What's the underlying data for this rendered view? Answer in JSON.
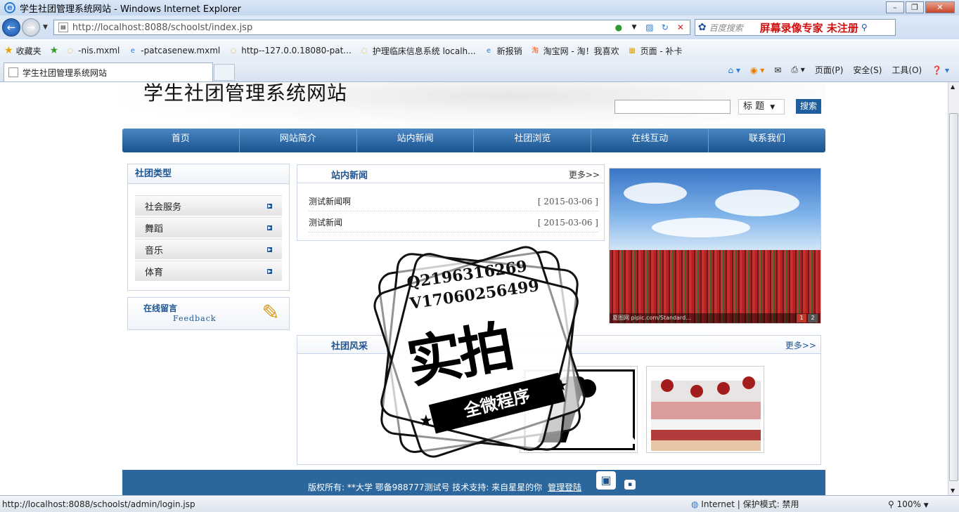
{
  "browser": {
    "window_title": "学生社团管理系统网站 - Windows Internet Explorer",
    "window_buttons": {
      "minimize": "–",
      "maximize": "❐",
      "close": "✕"
    },
    "address": "http://localhost:8088/schoolst/index.jsp",
    "search_placeholder": "百度搜索",
    "search_ad": "屏幕录像专家 未注册",
    "favorites_label": "收藏夹",
    "favorites": [
      {
        "label": "-nis.mxml",
        "icon": "loading-icon"
      },
      {
        "label": "-patcasenew.mxml",
        "icon": "ie-page-icon"
      },
      {
        "label": "http--127.0.0.18080-pat...",
        "icon": "loading-icon"
      },
      {
        "label": "护理临床信息系统 localh...",
        "icon": "loading-icon"
      },
      {
        "label": "新报销",
        "icon": "ie-page-icon"
      },
      {
        "label": "淘宝网 - 淘！我喜欢",
        "icon": "taobao-icon"
      },
      {
        "label": "页面 - 补卡",
        "icon": "page-icon"
      }
    ],
    "tab_title": "学生社团管理系统网站",
    "commands": {
      "page": "页面(P)",
      "safety": "安全(S)",
      "tools": "工具(O)"
    },
    "status_url": "http://localhost:8088/schoolst/admin/login.jsp",
    "status_zone": "Internet | 保护模式: 禁用",
    "status_zoom": "100%"
  },
  "site": {
    "title": "学生社团管理系统网站",
    "search": {
      "select_value": "标 题",
      "button": "搜索"
    },
    "nav": [
      "首页",
      "网站简介",
      "站内新闻",
      "社团浏览",
      "在线互动",
      "联系我们"
    ],
    "categories": {
      "title": "社团类型",
      "items": [
        "社会服务",
        "舞蹈",
        "音乐",
        "体育"
      ]
    },
    "feedback": {
      "title": "在线留言",
      "subtitle": "Feedback"
    },
    "news": {
      "title": "站内新闻",
      "more": "更多>>",
      "items": [
        {
          "title": "测试新闻啊",
          "date": "[ 2015-03-06 ]"
        },
        {
          "title": "测试新闻",
          "date": "[ 2015-03-06 ]"
        }
      ]
    },
    "slide": {
      "caption": "夏图网 pipic.com/Standard...",
      "pages": [
        "1",
        "2"
      ]
    },
    "clubs": {
      "title": "社团风采",
      "more": "更多>>"
    },
    "footer": {
      "text": "版权所有: **大学   鄂备988777测试号  技术支持: 来自星星的你",
      "admin_link": "管理登陆"
    }
  },
  "watermark": {
    "line1": "Q2196316269",
    "line2": "V17060256499",
    "big": "实拍",
    "ribbon": "全微程序"
  }
}
